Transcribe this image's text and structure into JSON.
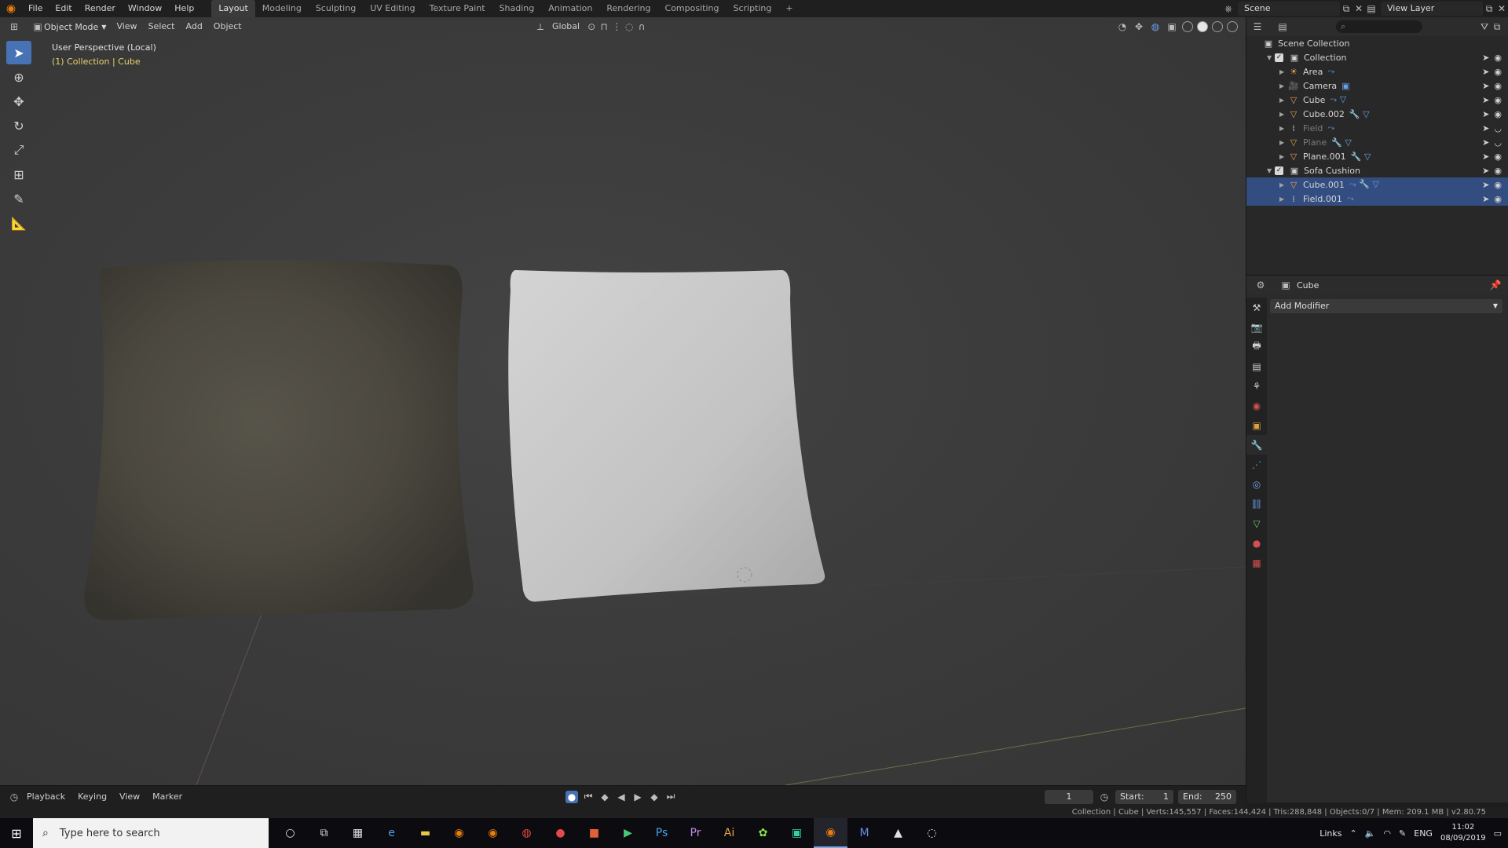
{
  "topbar": {
    "menus": [
      "File",
      "Edit",
      "Render",
      "Window",
      "Help"
    ],
    "workspaces": [
      "Layout",
      "Modeling",
      "Sculpting",
      "UV Editing",
      "Texture Paint",
      "Shading",
      "Animation",
      "Rendering",
      "Compositing",
      "Scripting"
    ],
    "add_tab": "+",
    "scene": "Scene",
    "view_layer": "View Layer"
  },
  "viewport": {
    "mode": "Object Mode",
    "menus": [
      "View",
      "Select",
      "Add",
      "Object"
    ],
    "orientation": "Global",
    "overlay_perspective": "User Perspective (Local)",
    "overlay_collection": "(1) Collection | Cube"
  },
  "outliner": {
    "root": "Scene Collection",
    "rows": [
      {
        "label": "Collection",
        "level": 1,
        "kind": "collection",
        "icon": "collection-icon",
        "expanded": true
      },
      {
        "label": "Area",
        "level": 2,
        "kind": "light",
        "icon": "light-icon",
        "extra": "⤳"
      },
      {
        "label": "Camera",
        "level": 2,
        "kind": "camera",
        "icon": "camera-icon",
        "extra": "▣"
      },
      {
        "label": "Cube",
        "level": 2,
        "kind": "mesh",
        "icon": "mesh-icon",
        "extra": "⤳ ▽"
      },
      {
        "label": "Cube.002",
        "level": 2,
        "kind": "mesh",
        "icon": "mesh-icon",
        "extra": "🔧 ▽"
      },
      {
        "label": "Field",
        "level": 2,
        "kind": "field",
        "icon": "field-icon",
        "extra": "⤳",
        "dim": true
      },
      {
        "label": "Plane",
        "level": 2,
        "kind": "mesh",
        "icon": "mesh-icon",
        "extra": "🔧 ▽",
        "dim": true
      },
      {
        "label": "Plane.001",
        "level": 2,
        "kind": "mesh",
        "icon": "mesh-icon",
        "extra": "🔧 ▽"
      },
      {
        "label": "Sofa Cushion",
        "level": 1,
        "kind": "collection",
        "icon": "collection-icon",
        "expanded": true
      },
      {
        "label": "Cube.001",
        "level": 2,
        "kind": "mesh",
        "icon": "mesh-icon",
        "extra": "⤳ 🔧 ▽",
        "selected": true
      },
      {
        "label": "Field.001",
        "level": 2,
        "kind": "field",
        "icon": "field-icon",
        "extra": "⤳",
        "selected": true
      }
    ]
  },
  "properties": {
    "object_name": "Cube",
    "add_modifier": "Add Modifier"
  },
  "timeline": {
    "menus": [
      "Playback",
      "Keying",
      "View",
      "Marker"
    ],
    "current_frame": "1",
    "start_label": "Start:",
    "start": "1",
    "end_label": "End:",
    "end": "250"
  },
  "statusbar": {
    "text": "Collection | Cube | Verts:145,557 | Faces:144,424 | Tris:288,848 | Objects:0/7 | Mem: 209.1 MB | v2.80.75"
  },
  "taskbar": {
    "search_placeholder": "Type here to search",
    "links": "Links",
    "lang": "ENG",
    "time": "11:02",
    "date": "08/09/2019"
  },
  "colors": {
    "accent": "#4772b3",
    "selected_row": "#334d80",
    "collection_text": "#e6d36a",
    "blender_orange": "#e87d0d"
  }
}
